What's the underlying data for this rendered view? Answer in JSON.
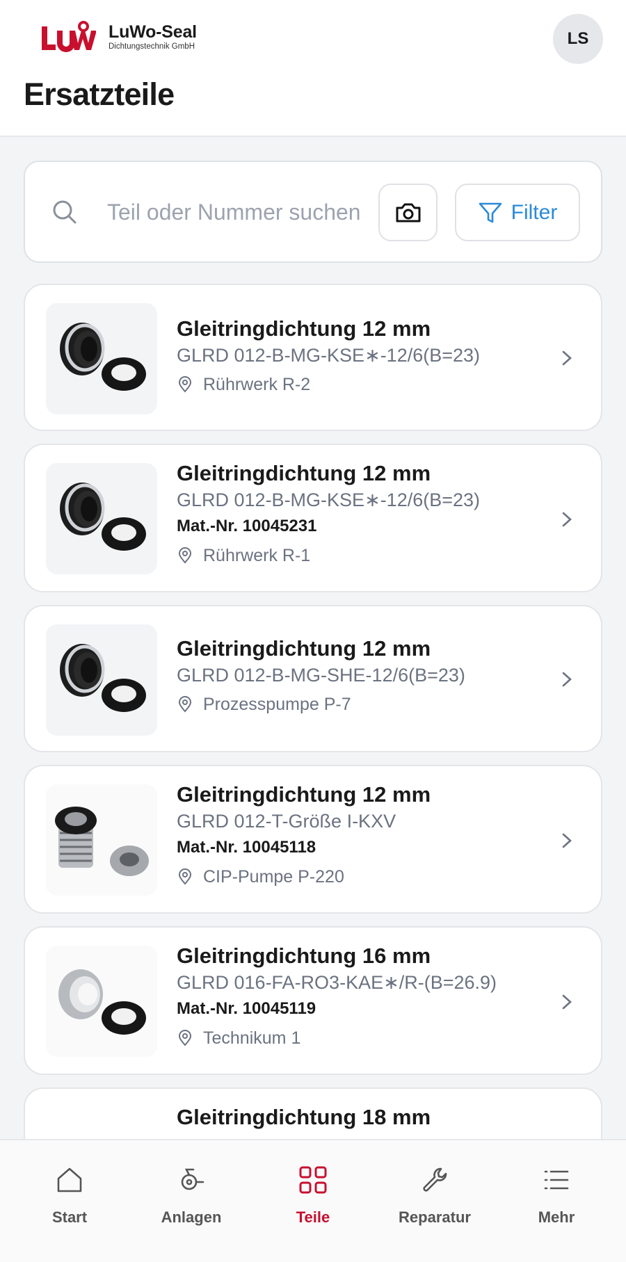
{
  "header": {
    "brand_name": "LuWo-Seal",
    "brand_sub": "Dichtungstechnik GmbH",
    "logo_text": "LuW",
    "avatar_initials": "LS",
    "page_title": "Ersatzteile"
  },
  "search": {
    "placeholder": "Teil oder Nummer suchen",
    "value": "",
    "icon": "search-icon",
    "camera_icon": "camera-icon",
    "filter_label": "Filter",
    "filter_icon": "filter-icon"
  },
  "parts": [
    {
      "title": "Gleitringdichtung 12 mm",
      "code": "GLRD 012-B-MG-KSE∗-12/6(B=23)",
      "mat": "",
      "location": "Rührwerk R-2",
      "image": "seal-black"
    },
    {
      "title": "Gleitringdichtung 12 mm",
      "code": "GLRD 012-B-MG-KSE∗-12/6(B=23)",
      "mat": "Mat.-Nr. 10045231",
      "location": "Rührwerk R-1",
      "image": "seal-black"
    },
    {
      "title": "Gleitringdichtung 12 mm",
      "code": "GLRD 012-B-MG-SHE-12/6(B=23)",
      "mat": "",
      "location": "Prozesspumpe P-7",
      "image": "seal-black"
    },
    {
      "title": "Gleitringdichtung 12 mm",
      "code": "GLRD 012-T-Größe I-KXV",
      "mat": "Mat.-Nr. 10045118",
      "location": "CIP-Pumpe P-220",
      "image": "seal-spring"
    },
    {
      "title": "Gleitringdichtung 16 mm",
      "code": "GLRD 016-FA-RO3-KAE∗/R-(B=26.9)",
      "mat": "Mat.-Nr. 10045119",
      "location": "Technikum 1",
      "image": "seal-silver"
    },
    {
      "title": "Gleitringdichtung 18 mm",
      "code": "",
      "mat": "",
      "location": "",
      "image": "seal-silver"
    }
  ],
  "nav": [
    {
      "label": "Start",
      "icon": "home-icon",
      "active": false
    },
    {
      "label": "Anlagen",
      "icon": "machine-icon",
      "active": false
    },
    {
      "label": "Teile",
      "icon": "grid-icon",
      "active": true
    },
    {
      "label": "Reparatur",
      "icon": "wrench-icon",
      "active": false
    },
    {
      "label": "Mehr",
      "icon": "menu-icon",
      "active": false
    }
  ],
  "colors": {
    "brand_red": "#c8102e",
    "accent_blue": "#2b8ad8",
    "text_muted": "#6b7280"
  }
}
